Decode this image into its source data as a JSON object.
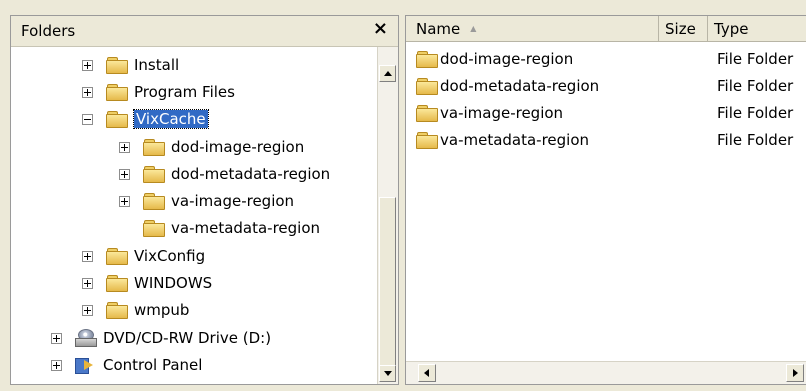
{
  "folders_pane": {
    "title": "Folders",
    "close_glyph": "×",
    "tree": [
      {
        "label": "Install",
        "icon": "folder-icon",
        "expander": "plus",
        "selected": false
      },
      {
        "label": "Program Files",
        "icon": "folder-icon",
        "expander": "plus",
        "selected": false
      },
      {
        "label": "VixCache",
        "icon": "folder-open-icon",
        "expander": "minus",
        "selected": true
      },
      {
        "label": "dod-image-region",
        "icon": "folder-icon",
        "expander": "plus",
        "selected": false
      },
      {
        "label": "dod-metadata-region",
        "icon": "folder-icon",
        "expander": "plus",
        "selected": false
      },
      {
        "label": "va-image-region",
        "icon": "folder-icon",
        "expander": "plus",
        "selected": false
      },
      {
        "label": "va-metadata-region",
        "icon": "folder-icon",
        "expander": "none",
        "selected": false
      },
      {
        "label": "VixConfig",
        "icon": "folder-icon",
        "expander": "plus",
        "selected": false
      },
      {
        "label": "WINDOWS",
        "icon": "folder-icon",
        "expander": "plus",
        "selected": false
      },
      {
        "label": "wmpub",
        "icon": "folder-icon",
        "expander": "plus",
        "selected": false
      },
      {
        "label": "DVD/CD-RW Drive (D:)",
        "icon": "cd-drive-icon",
        "expander": "plus",
        "selected": false
      },
      {
        "label": "Control Panel",
        "icon": "control-panel-icon",
        "expander": "plus",
        "selected": false
      }
    ]
  },
  "file_list": {
    "columns": {
      "name": "Name",
      "size": "Size",
      "type": "Type"
    },
    "sort_indicator": "▲",
    "rows": [
      {
        "name": "dod-image-region",
        "size": "",
        "type": "File Folder"
      },
      {
        "name": "dod-metadata-region",
        "size": "",
        "type": "File Folder"
      },
      {
        "name": "va-image-region",
        "size": "",
        "type": "File Folder"
      },
      {
        "name": "va-metadata-region",
        "size": "",
        "type": "File Folder"
      }
    ]
  },
  "colors": {
    "selection": "#316ac5",
    "window_face": "#ece9d8"
  }
}
